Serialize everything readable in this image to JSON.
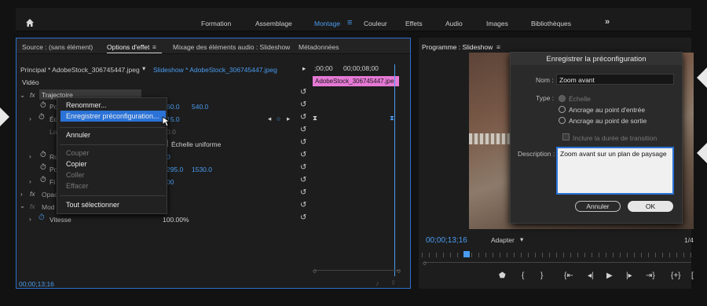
{
  "workspaces": [
    "Formation",
    "Assemblage",
    "Montage",
    "Couleur",
    "Effets",
    "Audio",
    "Images",
    "Bibliothèques"
  ],
  "left_tabs": [
    "Source : (sans élément)",
    "Options d'effet",
    "Mixage des éléments audio : Slideshow",
    "Métadonnées"
  ],
  "principal": "Principal * AdobeStock_306745447.jpeg",
  "sequence_clip": "Slideshow * AdobeStock_306745447.jpeg",
  "ruler": {
    "t1": ";00;00",
    "t2": "00;00;08;00"
  },
  "clip_label": "AdobeStock_306745447.jpe",
  "section_video": "Vidéo",
  "trajectoire": "Trajectoire",
  "rows": {
    "po": "Po",
    "ec": "Éc",
    "la": "La",
    "ro": "Ro",
    "po2": "Po",
    "fi": "Fi",
    "opac": "Opac",
    "mod": "Mod",
    "vitesse": "Vitesse"
  },
  "values": {
    "pos_a": "60.0",
    "pos_b": "540.0",
    "scale": "15.0",
    "la": "0.0",
    "ro": "0",
    "ap_a": "295.0",
    "ap_b": "1530.0",
    "fi": "00",
    "vitesse": "100.00%"
  },
  "echelle_uniforme": "Échelle uniforme",
  "context_menu": {
    "rename": "Renommer...",
    "save_preset": "Enregistrer préconfiguration...",
    "cancel": "Annuler",
    "cut": "Couper",
    "copy": "Copier",
    "paste": "Coller",
    "delete": "Effacer",
    "select_all": "Tout sélectionner"
  },
  "timecode": "00;00;13;16",
  "program_title": "Programme : Slideshow",
  "program_timecode": "00;00;13;16",
  "fit": "Adapter",
  "ratio": "1/4",
  "dialog": {
    "title": "Enregistrer la préconfiguration",
    "name_label": "Nom :",
    "name_value": "Zoom avant",
    "type_label": "Type :",
    "opt1": "Échelle",
    "opt2": "Ancrage au point d'entrée",
    "opt3": "Ancrage au point de sortie",
    "include": "Inclure la durée de transition",
    "desc_label": "Description :",
    "desc_value": "Zoom avant sur un plan de paysage",
    "cancel": "Annuler",
    "ok": "OK"
  },
  "colors": {
    "accent": "#4a9cf0",
    "clip": "#e679d6",
    "highlight": "#2b73d8"
  }
}
